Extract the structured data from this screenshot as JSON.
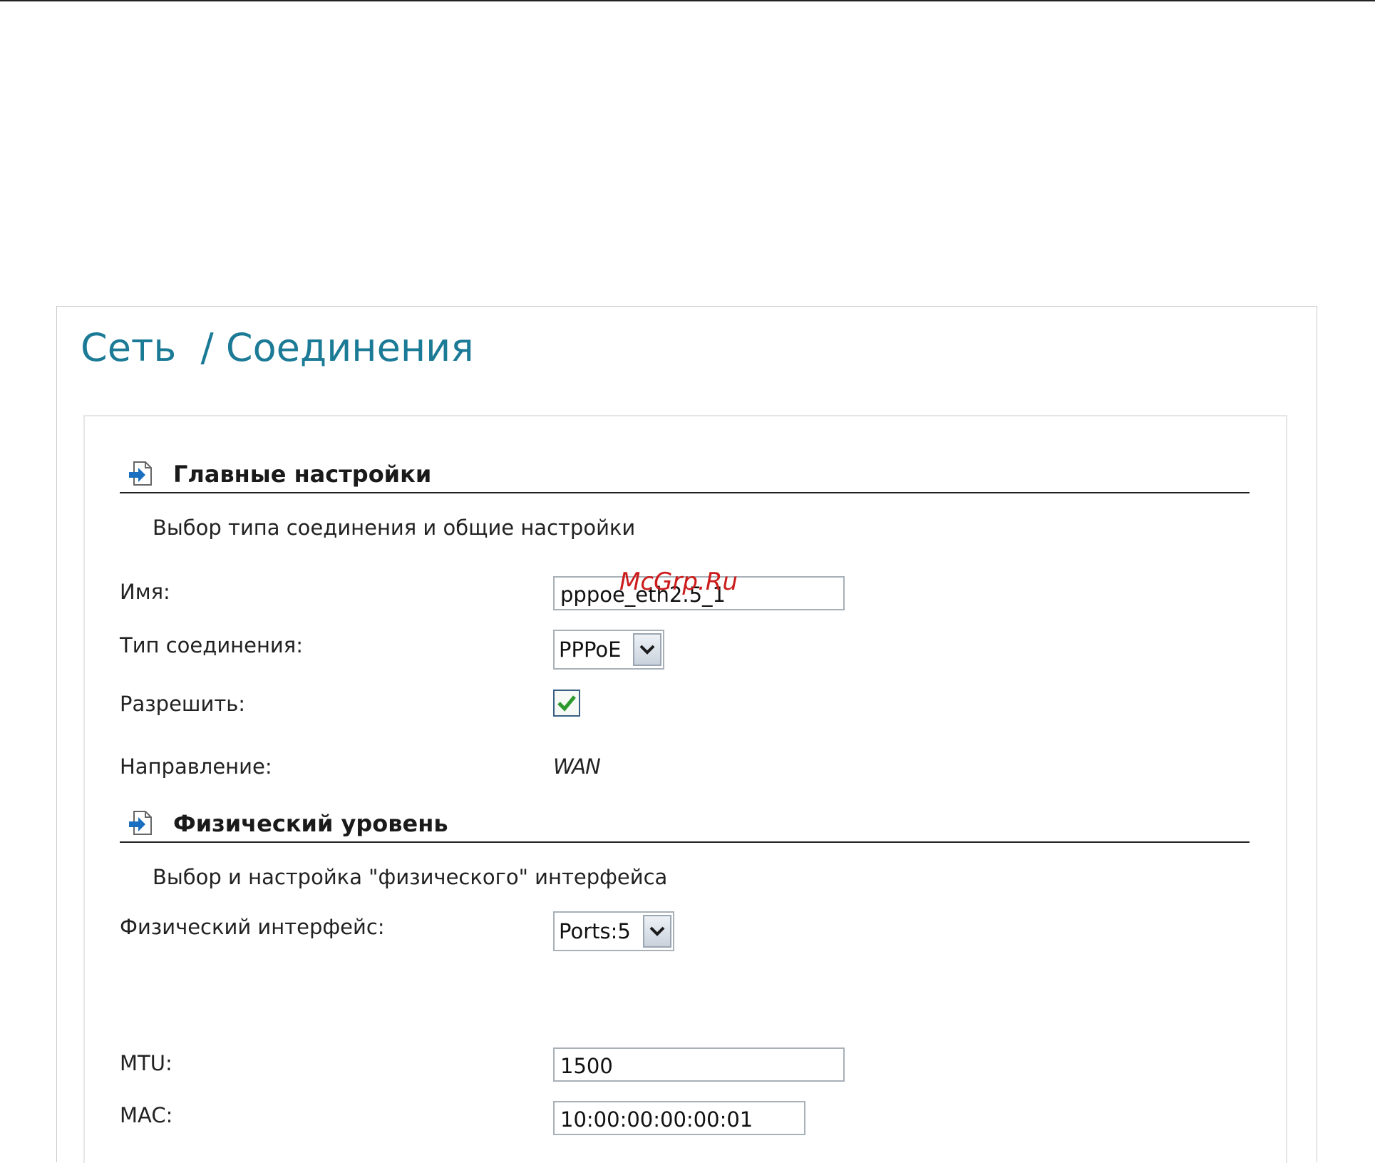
{
  "page": {
    "title": "Сеть  / Соединения"
  },
  "watermark": "McGrp.Ru",
  "main_settings": {
    "title": "Главные настройки",
    "description": "Выбор типа соединения и общие настройки",
    "name_label": "Имя:",
    "name_value": "pppoe_eth2.5_1",
    "conn_type_label": "Тип соединения:",
    "conn_type_value": "PPPoE",
    "enable_label": "Разрешить:",
    "enable_checked": true,
    "direction_label": "Направление:",
    "direction_value": "WAN"
  },
  "physical": {
    "title": "Физический уровень",
    "description": "Выбор и настройка \"физического\" интерфейса",
    "interface_label": "Физический интерфейс:",
    "interface_value": "Ports:5",
    "mtu_label": "MTU:",
    "mtu_value": "1500",
    "mac_label": "MAC:",
    "mac_value": "10:00:00:00:00:01"
  },
  "colors": {
    "title": "#1b7a96",
    "watermark": "#cc1c1c",
    "check": "#2e9a2e"
  },
  "icons": {
    "section": "page-arrow-icon",
    "dropdown": "chevron-down-icon",
    "check": "checkmark-icon"
  }
}
